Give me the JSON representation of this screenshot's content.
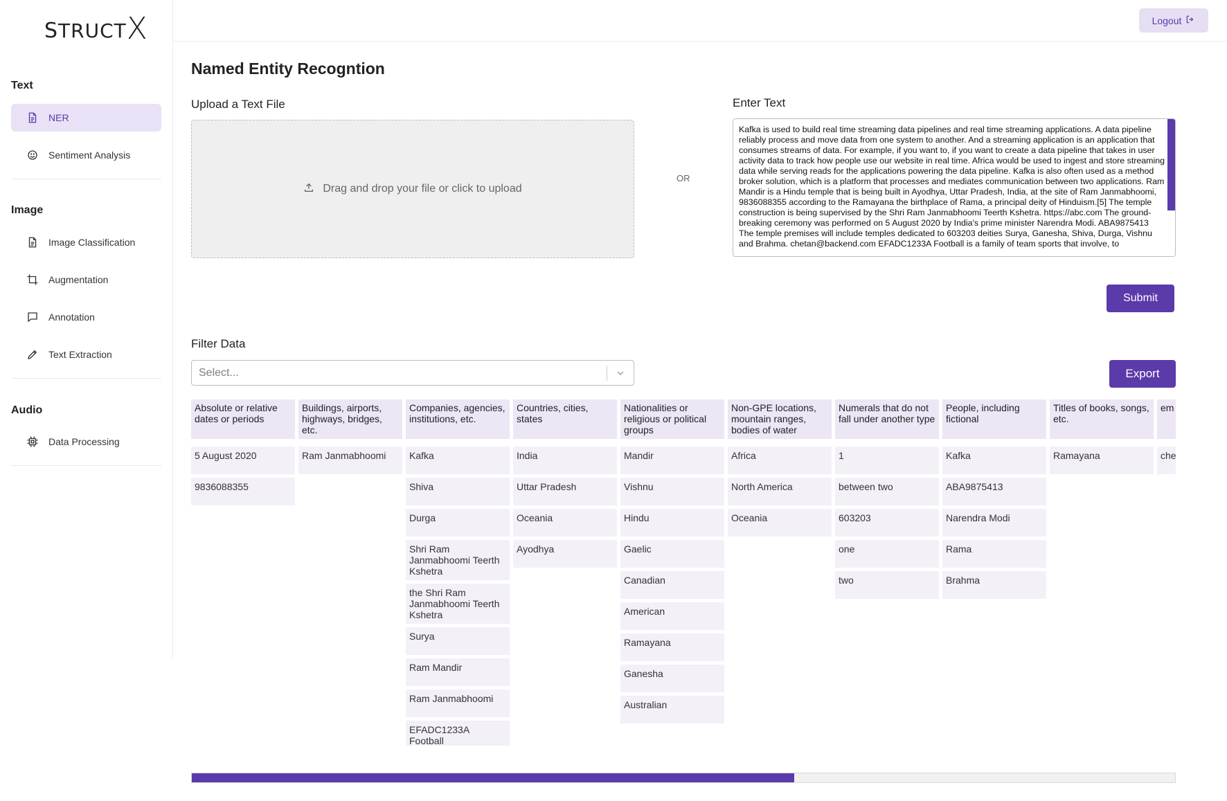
{
  "app": {
    "logo_prefix": "S",
    "logo_mid": "TRUCT",
    "logo_x": "X"
  },
  "sidebar": {
    "sections": [
      {
        "title": "Text",
        "items": [
          {
            "label": "NER",
            "icon": "document-icon",
            "active": true
          },
          {
            "label": "Sentiment Analysis",
            "icon": "smiley-icon"
          }
        ]
      },
      {
        "title": "Image",
        "items": [
          {
            "label": "Image Classification",
            "icon": "document-icon"
          },
          {
            "label": "Augmentation",
            "icon": "crop-icon"
          },
          {
            "label": "Annotation",
            "icon": "chat-icon"
          },
          {
            "label": "Text Extraction",
            "icon": "pencil-icon"
          }
        ]
      },
      {
        "title": "Audio",
        "items": [
          {
            "label": "Data Processing",
            "icon": "chip-icon"
          }
        ]
      }
    ]
  },
  "topbar": {
    "logout_label": "Logout"
  },
  "main": {
    "title": "Named Entity Recogntion",
    "upload_label": "Upload a Text File",
    "dropzone_text": "Drag and drop your file or click to upload",
    "or_label": "OR",
    "enter_text_label": "Enter Text",
    "textarea_value": "Kafka is used to build real time streaming data pipelines and real time streaming applications. A data pipeline reliably process and move data from one system to another. And a streaming application is an application that consumes streams of data. For example, if you want to, if you want to create a data pipeline that takes in user activity data to track how people use our website in real time. Africa would be used to ingest and store streaming data while serving reads for the applications powering the data pipeline. Kafka is also often used as a method broker solution, which is a platform that processes and mediates communication between two applications.  Ram Mandir is a Hindu temple that is being built in Ayodhya, Uttar Pradesh, India, at the site of Ram Janmabhoomi, 9836088355 according to the Ramayana the birthplace of Rama, a principal deity of Hinduism.[5] The temple construction is being supervised by the Shri Ram Janmabhoomi Teerth Kshetra. https://abc.com The ground-breaking ceremony was performed on 5 August 2020 by India's prime minister Narendra Modi. ABA9875413 The temple premises will include temples dedicated to 603203 deities Surya, Ganesha, Shiva, Durga, Vishnu and Brahma. chetan@backend.com EFADC1233A Football is a family of team sports that involve, to",
    "submit_label": "Submit",
    "filter_label": "Filter Data",
    "filter_placeholder": "Select...",
    "export_label": "Export",
    "progress_fraction": 0.613
  },
  "table": {
    "columns": [
      {
        "header": "Absolute or relative dates or periods",
        "values": [
          "5 August 2020",
          "9836088355"
        ]
      },
      {
        "header": "Buildings, airports, highways, bridges, etc.",
        "values": [
          "Ram Janmabhoomi"
        ]
      },
      {
        "header": "Companies, agencies, institutions, etc.",
        "values": [
          "Kafka",
          "Shiva",
          "Durga",
          "Shri Ram Janmabhoomi Teerth Kshetra",
          "the Shri Ram Janmabhoomi Teerth Kshetra",
          "Surya",
          "Ram Mandir",
          "Ram Janmabhoomi",
          "EFADC1233A Football"
        ]
      },
      {
        "header": "Countries, cities, states",
        "values": [
          "India",
          "Uttar Pradesh",
          "Oceania",
          "Ayodhya"
        ]
      },
      {
        "header": "Nationalities or religious or political groups",
        "values": [
          "Mandir",
          "Vishnu",
          "Hindu",
          "Gaelic",
          "Canadian",
          "American",
          "Ramayana",
          "Ganesha",
          "Australian"
        ]
      },
      {
        "header": "Non-GPE locations, mountain ranges, bodies of water",
        "values": [
          "Africa",
          "North America",
          "Oceania"
        ]
      },
      {
        "header": "Numerals that do not fall under another type",
        "values": [
          "1",
          "between two",
          "603203",
          "one",
          "two"
        ]
      },
      {
        "header": "People, including fictional",
        "values": [
          "Kafka",
          "ABA9875413",
          "Narendra Modi",
          "Rama",
          "Brahma"
        ]
      },
      {
        "header": "Titles of books, songs, etc.",
        "values": [
          "Ramayana"
        ]
      },
      {
        "header": "em",
        "values": [
          "che"
        ]
      }
    ]
  }
}
